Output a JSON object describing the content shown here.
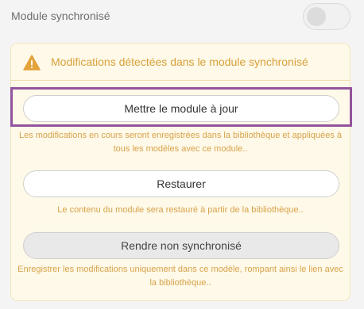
{
  "sync": {
    "label": "Module synchronisé",
    "toggle_on": false
  },
  "warning": {
    "icon": "warning-triangle-icon",
    "title": "Modifications détectées dans le module synchronisé"
  },
  "actions": [
    {
      "label": "Mettre le module à jour",
      "description": "Les modifications en cours seront enregistrées dans la bibliothèque et appliquées à tous les modèles avec ce module.."
    },
    {
      "label": "Restaurer",
      "description": "Le contenu du module sera restauré à partir de la bibliothèque.."
    },
    {
      "label": "Rendre non synchronisé",
      "description": "Enregistrer les modifications uniquement dans ce modèle, rompant ainsi le lien avec la bibliothèque.."
    }
  ],
  "colors": {
    "accent_warning": "#d9a13b",
    "panel_background": "#fef9e8",
    "highlight_border": "#93539c"
  }
}
